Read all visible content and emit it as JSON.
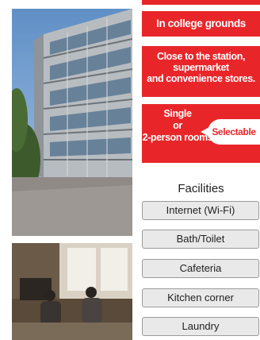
{
  "info_boxes": {
    "grounds": "In college grounds",
    "station_lines": [
      "Close to the station,",
      "supermarket",
      "and convenience stores."
    ],
    "rooms_lines": [
      "Single",
      "or",
      "2-person rooms"
    ],
    "selectable": "Selectable"
  },
  "facilities": {
    "title": "Facilities",
    "items": [
      "Internet (Wi-Fi)",
      "Bath/Toilet",
      "Cafeteria",
      "Kitchen corner",
      "Laundry"
    ]
  },
  "colors": {
    "accent": "#e8262a",
    "facility_bg": "#e9e9e9"
  }
}
